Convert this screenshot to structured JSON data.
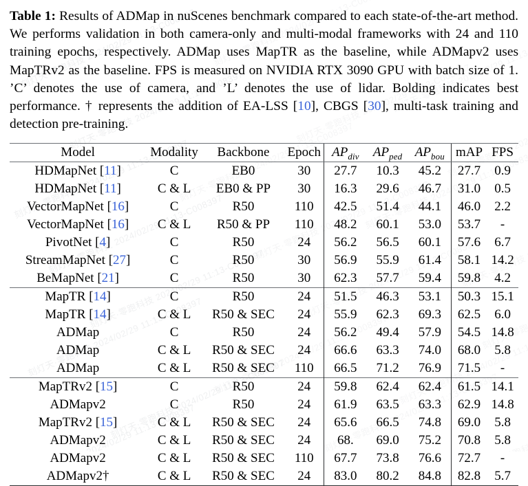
{
  "caption": {
    "label": "Table 1:",
    "text_1": " Results of ADMap in nuScenes benchmark compared to each state-of-the-art method. We performs validation in both camera-only and multi-modal frameworks with 24 and 110 training epochs, respectively. ADMap uses MapTR as the baseline, while ADMapv2 uses MapTRv2 as the baseline. FPS is measured on NVIDIA RTX 3090 GPU with batch size of 1. ’C’ denotes the use of camera, and ’L’ denotes the use of lidar. Bolding indicates best performance. † represents the addition of EA-LSS [",
    "cite_1": "10",
    "text_2": "], CBGS [",
    "cite_2": "30",
    "text_3": "], multi-task training and detection pre-training."
  },
  "colors": {
    "citation_blue": "#3a63d8",
    "rule_gray": "#6b6f74",
    "rule_dark": "#2b2d2f",
    "text": "#000000",
    "background": "#ffffff"
  },
  "table": {
    "headers": {
      "model": "Model",
      "modality": "Modality",
      "backbone": "Backbone",
      "epoch": "Epoch",
      "ap_div": "AP",
      "ap_div_sub": "div",
      "ap_ped": "AP",
      "ap_ped_sub": "ped",
      "ap_bou": "AP",
      "ap_bou_sub": "bou",
      "map": "mAP",
      "fps": "FPS"
    },
    "groups": [
      {
        "rows": [
          {
            "model": "HDMapNet",
            "cite": "11",
            "dagger": "",
            "modality": "C",
            "backbone": "EB0",
            "epoch": "30",
            "ap_div": "27.7",
            "ap_ped": "10.3",
            "ap_bou": "45.2",
            "map": "27.7",
            "fps": "0.9",
            "bold": []
          },
          {
            "model": "HDMapNet",
            "cite": "11",
            "dagger": "",
            "modality": "C & L",
            "backbone": "EB0 & PP",
            "epoch": "30",
            "ap_div": "16.3",
            "ap_ped": "29.6",
            "ap_bou": "46.7",
            "map": "31.0",
            "fps": "0.5",
            "bold": []
          },
          {
            "model": "VectorMapNet",
            "cite": "16",
            "dagger": "",
            "modality": "C",
            "backbone": "R50",
            "epoch": "110",
            "ap_div": "42.5",
            "ap_ped": "51.4",
            "ap_bou": "44.1",
            "map": "46.0",
            "fps": "2.2",
            "bold": []
          },
          {
            "model": "VectorMapNet",
            "cite": "16",
            "dagger": "",
            "modality": "C & L",
            "backbone": "R50 & PP",
            "epoch": "110",
            "ap_div": "48.2",
            "ap_ped": "60.1",
            "ap_bou": "53.0",
            "map": "53.7",
            "fps": "-",
            "bold": []
          },
          {
            "model": "PivotNet",
            "cite": "4",
            "dagger": "",
            "modality": "C",
            "backbone": "R50",
            "epoch": "24",
            "ap_div": "56.2",
            "ap_ped": "56.5",
            "ap_bou": "60.1",
            "map": "57.6",
            "fps": "6.7",
            "bold": []
          },
          {
            "model": "StreamMapNet",
            "cite": "27",
            "dagger": "",
            "modality": "C",
            "backbone": "R50",
            "epoch": "30",
            "ap_div": "56.9",
            "ap_ped": "55.9",
            "ap_bou": "61.4",
            "map": "58.1",
            "fps": "14.2",
            "bold": []
          },
          {
            "model": "BeMapNet",
            "cite": "21",
            "dagger": "",
            "modality": "C",
            "backbone": "R50",
            "epoch": "30",
            "ap_div": "62.3",
            "ap_ped": "57.7",
            "ap_bou": "59.4",
            "map": "59.8",
            "fps": "4.2",
            "bold": []
          }
        ]
      },
      {
        "rows": [
          {
            "model": "MapTR",
            "cite": "14",
            "dagger": "",
            "modality": "C",
            "backbone": "R50",
            "epoch": "24",
            "ap_div": "51.5",
            "ap_ped": "46.3",
            "ap_bou": "53.1",
            "map": "50.3",
            "fps": "15.1",
            "bold": [
              "fps"
            ]
          },
          {
            "model": "MapTR",
            "cite": "14",
            "dagger": "",
            "modality": "C & L",
            "backbone": "R50 & SEC",
            "epoch": "24",
            "ap_div": "55.9",
            "ap_ped": "62.3",
            "ap_bou": "69.3",
            "map": "62.5",
            "fps": "6.0",
            "bold": []
          },
          {
            "model": "ADMap",
            "cite": "",
            "dagger": "",
            "modality": "C",
            "backbone": "R50",
            "epoch": "24",
            "ap_div": "56.2",
            "ap_ped": "49.4",
            "ap_bou": "57.9",
            "map": "54.5",
            "fps": "14.8",
            "bold": []
          },
          {
            "model": "ADMap",
            "cite": "",
            "dagger": "",
            "modality": "C & L",
            "backbone": "R50 & SEC",
            "epoch": "24",
            "ap_div": "66.6",
            "ap_ped": "63.3",
            "ap_bou": "74.0",
            "map": "68.0",
            "fps": "5.8",
            "bold": []
          },
          {
            "model": "ADMap",
            "cite": "",
            "dagger": "",
            "modality": "C & L",
            "backbone": "R50 & SEC",
            "epoch": "110",
            "ap_div": "66.5",
            "ap_ped": "71.2",
            "ap_bou": "76.9",
            "map": "71.5",
            "fps": "-",
            "bold": []
          }
        ]
      },
      {
        "rows": [
          {
            "model": "MapTRv2",
            "cite": "15",
            "dagger": "",
            "modality": "C",
            "backbone": "R50",
            "epoch": "24",
            "ap_div": "59.8",
            "ap_ped": "62.4",
            "ap_bou": "62.4",
            "map": "61.5",
            "fps": "14.1",
            "bold": []
          },
          {
            "model": "ADMapv2",
            "cite": "",
            "dagger": "",
            "modality": "C",
            "backbone": "R50",
            "epoch": "24",
            "ap_div": "61.9",
            "ap_ped": "63.5",
            "ap_bou": "63.3",
            "map": "62.9",
            "fps": "14.8",
            "bold": []
          },
          {
            "model": "MapTRv2",
            "cite": "15",
            "dagger": "",
            "modality": "C & L",
            "backbone": "R50 & SEC",
            "epoch": "24",
            "ap_div": "65.6",
            "ap_ped": "66.5",
            "ap_bou": "74.8",
            "map": "69.0",
            "fps": "5.8",
            "bold": []
          },
          {
            "model": "ADMapv2",
            "cite": "",
            "dagger": "",
            "modality": "C & L",
            "backbone": "R50 & SEC",
            "epoch": "24",
            "ap_div": "68.",
            "ap_ped": "69.0",
            "ap_bou": "75.2",
            "map": "70.8",
            "fps": "5.8",
            "bold": []
          },
          {
            "model": "ADMapv2",
            "cite": "",
            "dagger": "",
            "modality": "C & L",
            "backbone": "R50 & SEC",
            "epoch": "110",
            "ap_div": "67.7",
            "ap_ped": "73.8",
            "ap_bou": "76.6",
            "map": "72.7",
            "fps": "-",
            "bold": []
          },
          {
            "model": "ADMapv2",
            "cite": "",
            "dagger": "†",
            "modality": "C & L",
            "backbone": "R50 & SEC",
            "epoch": "24",
            "ap_div": "83.0",
            "ap_ped": "80.2",
            "ap_bou": "84.8",
            "map": "82.8",
            "fps": "5.7",
            "bold": [
              "ap_div",
              "ap_ped",
              "ap_bou",
              "map"
            ]
          }
        ]
      }
    ]
  },
  "chart_data": {
    "type": "table",
    "title": "Results of ADMap in nuScenes benchmark compared to each state-of-the-art method",
    "columns": [
      "Model",
      "Modality",
      "Backbone",
      "Epoch",
      "AP_div",
      "AP_ped",
      "AP_bou",
      "mAP",
      "FPS"
    ],
    "rows": [
      [
        "HDMapNet [11]",
        "C",
        "EB0",
        30,
        27.7,
        10.3,
        45.2,
        27.7,
        0.9
      ],
      [
        "HDMapNet [11]",
        "C & L",
        "EB0 & PP",
        30,
        16.3,
        29.6,
        46.7,
        31.0,
        0.5
      ],
      [
        "VectorMapNet [16]",
        "C",
        "R50",
        110,
        42.5,
        51.4,
        44.1,
        46.0,
        2.2
      ],
      [
        "VectorMapNet [16]",
        "C & L",
        "R50 & PP",
        110,
        48.2,
        60.1,
        53.0,
        53.7,
        null
      ],
      [
        "PivotNet [4]",
        "C",
        "R50",
        24,
        56.2,
        56.5,
        60.1,
        57.6,
        6.7
      ],
      [
        "StreamMapNet [27]",
        "C",
        "R50",
        30,
        56.9,
        55.9,
        61.4,
        58.1,
        14.2
      ],
      [
        "BeMapNet [21]",
        "C",
        "R50",
        30,
        62.3,
        57.7,
        59.4,
        59.8,
        4.2
      ],
      [
        "MapTR [14]",
        "C",
        "R50",
        24,
        51.5,
        46.3,
        53.1,
        50.3,
        15.1
      ],
      [
        "MapTR [14]",
        "C & L",
        "R50 & SEC",
        24,
        55.9,
        62.3,
        69.3,
        62.5,
        6.0
      ],
      [
        "ADMap",
        "C",
        "R50",
        24,
        56.2,
        49.4,
        57.9,
        54.5,
        14.8
      ],
      [
        "ADMap",
        "C & L",
        "R50 & SEC",
        24,
        66.6,
        63.3,
        74.0,
        68.0,
        5.8
      ],
      [
        "ADMap",
        "C & L",
        "R50 & SEC",
        110,
        66.5,
        71.2,
        76.9,
        71.5,
        null
      ],
      [
        "MapTRv2 [15]",
        "C",
        "R50",
        24,
        59.8,
        62.4,
        62.4,
        61.5,
        14.1
      ],
      [
        "ADMapv2",
        "C",
        "R50",
        24,
        61.9,
        63.5,
        63.3,
        62.9,
        14.8
      ],
      [
        "MapTRv2 [15]",
        "C & L",
        "R50 & SEC",
        24,
        65.6,
        66.5,
        74.8,
        69.0,
        5.8
      ],
      [
        "ADMapv2",
        "C & L",
        "R50 & SEC",
        24,
        68.0,
        69.0,
        75.2,
        70.8,
        5.8
      ],
      [
        "ADMapv2",
        "C & L",
        "R50 & SEC",
        110,
        67.7,
        73.8,
        76.6,
        72.7,
        null
      ],
      [
        "ADMapv2†",
        "C & L",
        "R50 & SEC",
        24,
        83.0,
        80.2,
        84.8,
        82.8,
        5.7
      ]
    ],
    "best_values": {
      "AP_div": 83.0,
      "AP_ped": 80.2,
      "AP_bou": 84.8,
      "mAP": 82.8,
      "FPS": 15.1
    }
  },
  "watermark": {
    "text": "刻灯天·零跑科技 2024/02/29 11:13-C008397"
  }
}
